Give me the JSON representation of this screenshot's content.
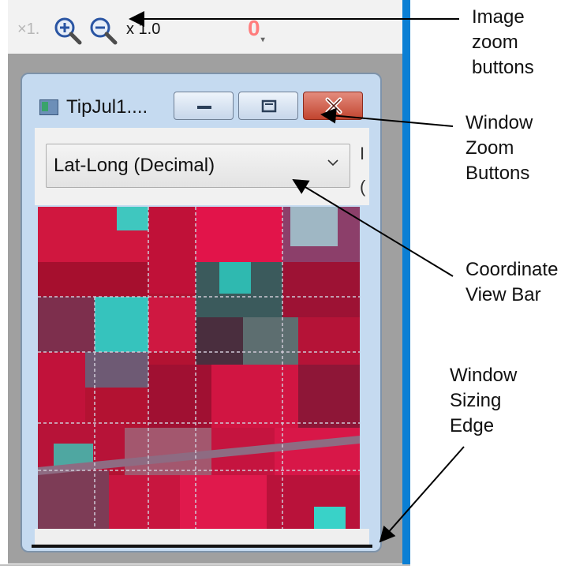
{
  "toolbar": {
    "tool_label": "×1.",
    "zoom_level": "x 1.0",
    "red_tool_label": "0",
    "zoom_in_icon": "zoom-in-icon",
    "zoom_out_icon": "zoom-out-icon"
  },
  "window": {
    "title": "TipJul1....",
    "minimize_icon": "minimize-icon",
    "maximize_icon": "maximize-icon",
    "close_icon": "close-icon"
  },
  "coordinate_bar": {
    "selected": "Lat-Long (Decimal)",
    "side_label_1": "I",
    "side_label_2": "("
  },
  "annotations": {
    "image_zoom": "Image\nzoom\nbuttons",
    "window_zoom": "Window\nZoom\nButtons",
    "coordinate_bar": "Coordinate\nView Bar",
    "sizing_edge": "Window\nSizing\nEdge"
  },
  "colors": {
    "accent_blue": "#0b7fd4",
    "window_frame": "#c5daf0",
    "close_red": "#c2452f",
    "image_red": "#b81134",
    "image_cyan": "#39d2c8"
  }
}
